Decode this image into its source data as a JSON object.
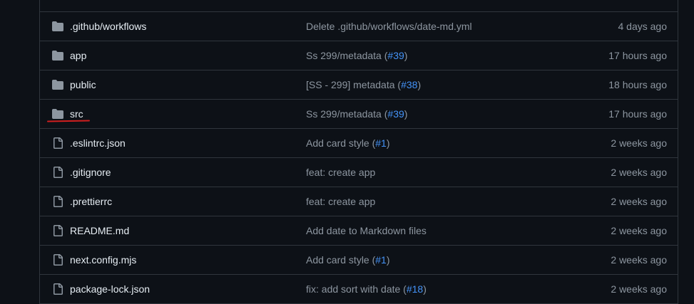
{
  "files": [
    {
      "type": "folder",
      "name": ".github/workflows",
      "commit_text": "Delete .github/workflows/date-md.yml",
      "commit_pr": "",
      "commit_suffix": "",
      "age": "4 days ago"
    },
    {
      "type": "folder",
      "name": "app",
      "commit_text": "Ss 299/metadata (",
      "commit_pr": "#39",
      "commit_suffix": ")",
      "age": "17 hours ago"
    },
    {
      "type": "folder",
      "name": "public",
      "commit_text": "[SS - 299] metadata (",
      "commit_pr": "#38",
      "commit_suffix": ")",
      "age": "18 hours ago"
    },
    {
      "type": "folder",
      "name": "src",
      "commit_text": "Ss 299/metadata (",
      "commit_pr": "#39",
      "commit_suffix": ")",
      "age": "17 hours ago",
      "annotated": true
    },
    {
      "type": "file",
      "name": ".eslintrc.json",
      "commit_text": "Add card style (",
      "commit_pr": "#1",
      "commit_suffix": ")",
      "age": "2 weeks ago"
    },
    {
      "type": "file",
      "name": ".gitignore",
      "commit_text": "feat: create app",
      "commit_pr": "",
      "commit_suffix": "",
      "age": "2 weeks ago"
    },
    {
      "type": "file",
      "name": ".prettierrc",
      "commit_text": "feat: create app",
      "commit_pr": "",
      "commit_suffix": "",
      "age": "2 weeks ago"
    },
    {
      "type": "file",
      "name": "README.md",
      "commit_text": "Add date to Markdown files",
      "commit_pr": "",
      "commit_suffix": "",
      "age": "2 weeks ago"
    },
    {
      "type": "file",
      "name": "next.config.mjs",
      "commit_text": "Add card style (",
      "commit_pr": "#1",
      "commit_suffix": ")",
      "age": "2 weeks ago"
    },
    {
      "type": "file",
      "name": "package-lock.json",
      "commit_text": "fix: add sort with date (",
      "commit_pr": "#18",
      "commit_suffix": ")",
      "age": "2 weeks ago"
    }
  ],
  "colors": {
    "background": "#0d1117",
    "border": "#30363d",
    "text": "#e6edf3",
    "muted": "#8d96a0",
    "link": "#4493f8",
    "icon": "#8d96a0",
    "annotation": "#d11f1f"
  },
  "icons": {
    "folder": "folder-icon",
    "file": "file-icon"
  }
}
